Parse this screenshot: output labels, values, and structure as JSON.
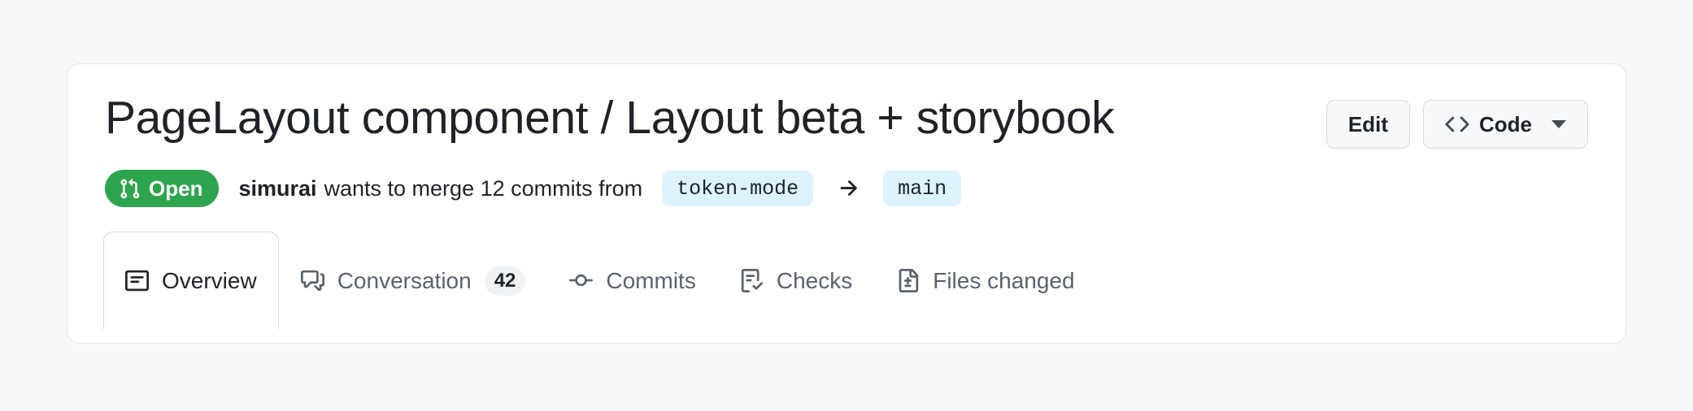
{
  "header": {
    "title": "PageLayout component / Layout beta + storybook",
    "actions": [
      {
        "label": "Edit",
        "icon": null,
        "has_caret": false,
        "name": "edit-button"
      },
      {
        "label": "Code",
        "icon": "code-icon",
        "has_caret": true,
        "name": "code-button"
      }
    ]
  },
  "meta": {
    "state_label": "Open",
    "state_icon": "git-pull-request-icon",
    "state_color": "#2da44e",
    "author": "simurai",
    "description": "wants to merge 12 commits from",
    "source_branch": "token-mode",
    "arrow_icon": "arrow-right-icon",
    "target_branch": "main",
    "branch_chip_color": "#ddf4ff"
  },
  "tabs": [
    {
      "label": "Overview",
      "icon": "overview-icon",
      "count": null,
      "selected": true
    },
    {
      "label": "Conversation",
      "icon": "comment-discussion-icon",
      "count": "42",
      "selected": false
    },
    {
      "label": "Commits",
      "icon": "git-commit-icon",
      "count": null,
      "selected": false
    },
    {
      "label": "Checks",
      "icon": "checklist-icon",
      "count": null,
      "selected": false
    },
    {
      "label": "Files changed",
      "icon": "file-diff-icon",
      "count": null,
      "selected": false
    }
  ]
}
